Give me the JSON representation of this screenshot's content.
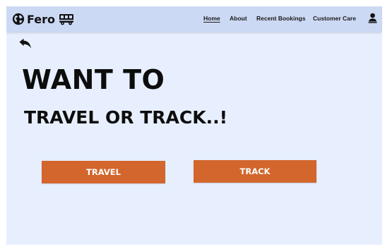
{
  "brand": {
    "name": "Fero",
    "logo_icon": "globe-icon",
    "vehicle_icon": "bus-icon"
  },
  "nav": {
    "items": [
      {
        "label": "Home",
        "active": true
      },
      {
        "label": "About",
        "active": false
      },
      {
        "label": "Recent Bookings",
        "active": false
      },
      {
        "label": "Customer Care",
        "active": false
      }
    ],
    "user_icon": "user-icon"
  },
  "back": {
    "icon": "back-arrow-icon"
  },
  "hero": {
    "line1": "WANT TO",
    "line2": "TRAVEL OR TRACK..!"
  },
  "actions": {
    "travel_label": "TRAVEL",
    "track_label": "TRACK"
  },
  "colors": {
    "page_background": "#e7efff",
    "navbar_background": "#ccd9f4",
    "button_accent": "#d2662c",
    "button_text": "#ffffff"
  }
}
